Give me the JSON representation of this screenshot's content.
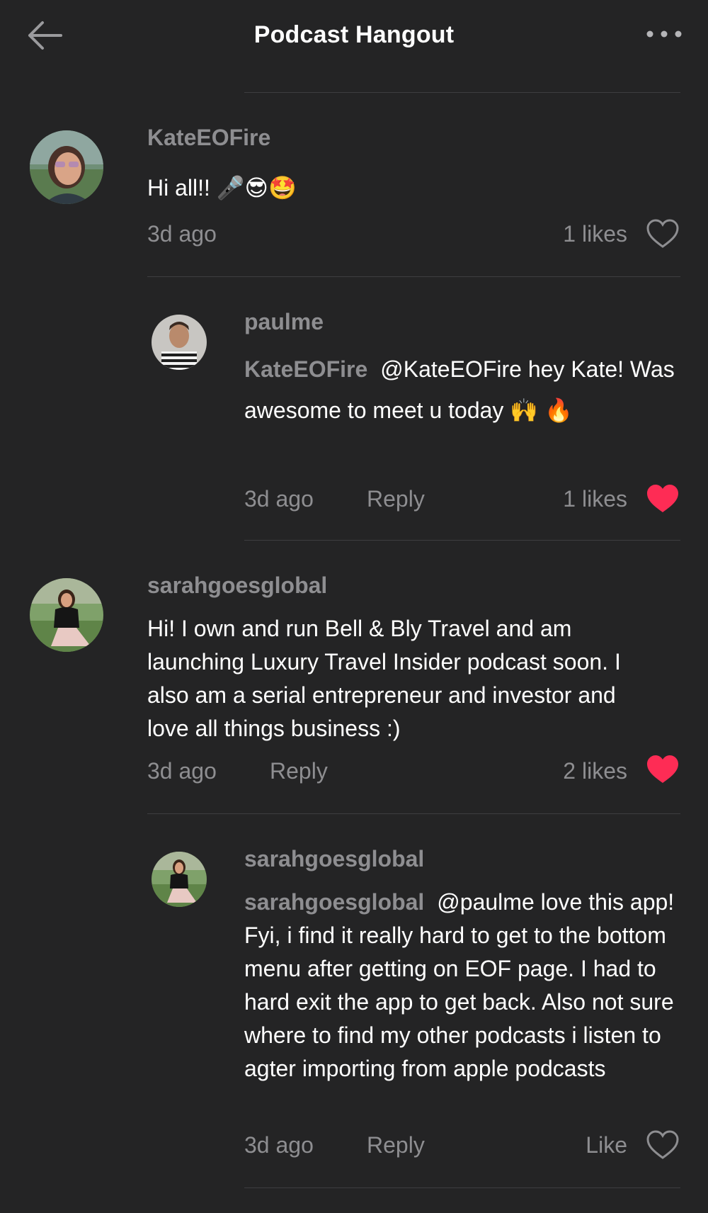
{
  "header": {
    "title": "Podcast Hangout",
    "back_icon": "arrow-left-icon",
    "more_icon": "more-horizontal-icon"
  },
  "colors": {
    "background": "#242425",
    "text_primary": "#ffffff",
    "text_secondary": "#8e8e91",
    "liked_heart": "#fe2c55",
    "divider": "#3e3e40"
  },
  "comments": [
    {
      "username": "KateEOFire",
      "text": "Hi all!! 🎤😎🤩",
      "time": "3d ago",
      "likes": "1 likes",
      "liked": false
    },
    {
      "username": "paulme",
      "reply_to": "KateEOFire",
      "text": "@KateEOFire hey Kate! Was awesome to meet u today 🙌 🔥",
      "time": "3d ago",
      "reply_label": "Reply",
      "likes": "1 likes",
      "liked": true
    },
    {
      "username": "sarahgoesglobal",
      "text": "Hi! I own and run Bell & Bly Travel and am launching Luxury Travel Insider podcast soon. I also am a serial entrepreneur and investor and love all things business :)",
      "time": "3d ago",
      "reply_label": "Reply",
      "likes": "2 likes",
      "liked": true
    },
    {
      "username": "sarahgoesglobal",
      "reply_to": "sarahgoesglobal",
      "text": "@paulme love this app! Fyi, i find it really hard to get to the bottom menu after getting on EOF page. I had to hard exit the app to get back. Also not sure where to find my other podcasts i listen to agter importing from apple podcasts",
      "time": "3d ago",
      "reply_label": "Reply",
      "likes": "Like",
      "liked": false
    }
  ]
}
